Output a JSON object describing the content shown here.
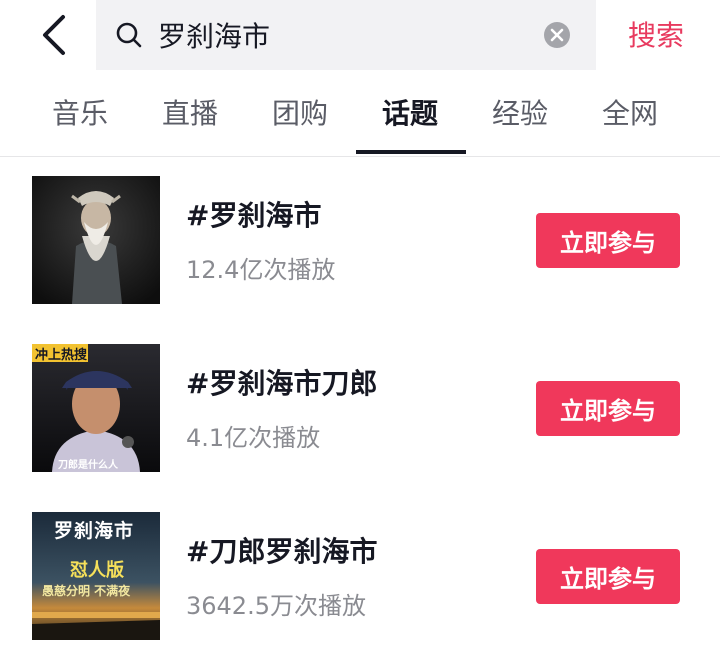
{
  "header": {
    "back_icon": "chevron-left-icon",
    "search_query": "罗刹海市",
    "search_icon": "search-icon",
    "clear_icon": "clear-icon",
    "search_button": "搜索"
  },
  "tabs": [
    {
      "label": "音乐"
    },
    {
      "label": "直播"
    },
    {
      "label": "团购"
    },
    {
      "label": "话题",
      "active": true
    },
    {
      "label": "经验"
    },
    {
      "label": "全网"
    }
  ],
  "results": [
    {
      "title": "#罗刹海市",
      "plays": "12.4亿次播放",
      "action": "立即参与"
    },
    {
      "title": "#罗刹海市刀郎",
      "plays": "4.1亿次播放",
      "action": "立即参与",
      "thumb_text_top": "冲上热搜",
      "thumb_text_bottom": "刀郎是什么人"
    },
    {
      "title": "#刀郎罗刹海市",
      "plays": "3642.5万次播放",
      "action": "立即参与",
      "thumb_title": "罗刹海市",
      "thumb_sub": "怼人版",
      "thumb_caption": "愚慈分明 不满夜"
    }
  ],
  "colors": {
    "accent": "#f0385b",
    "search_accent": "#e83a5f",
    "text_primary": "#161823",
    "text_secondary": "#8a8b91"
  }
}
